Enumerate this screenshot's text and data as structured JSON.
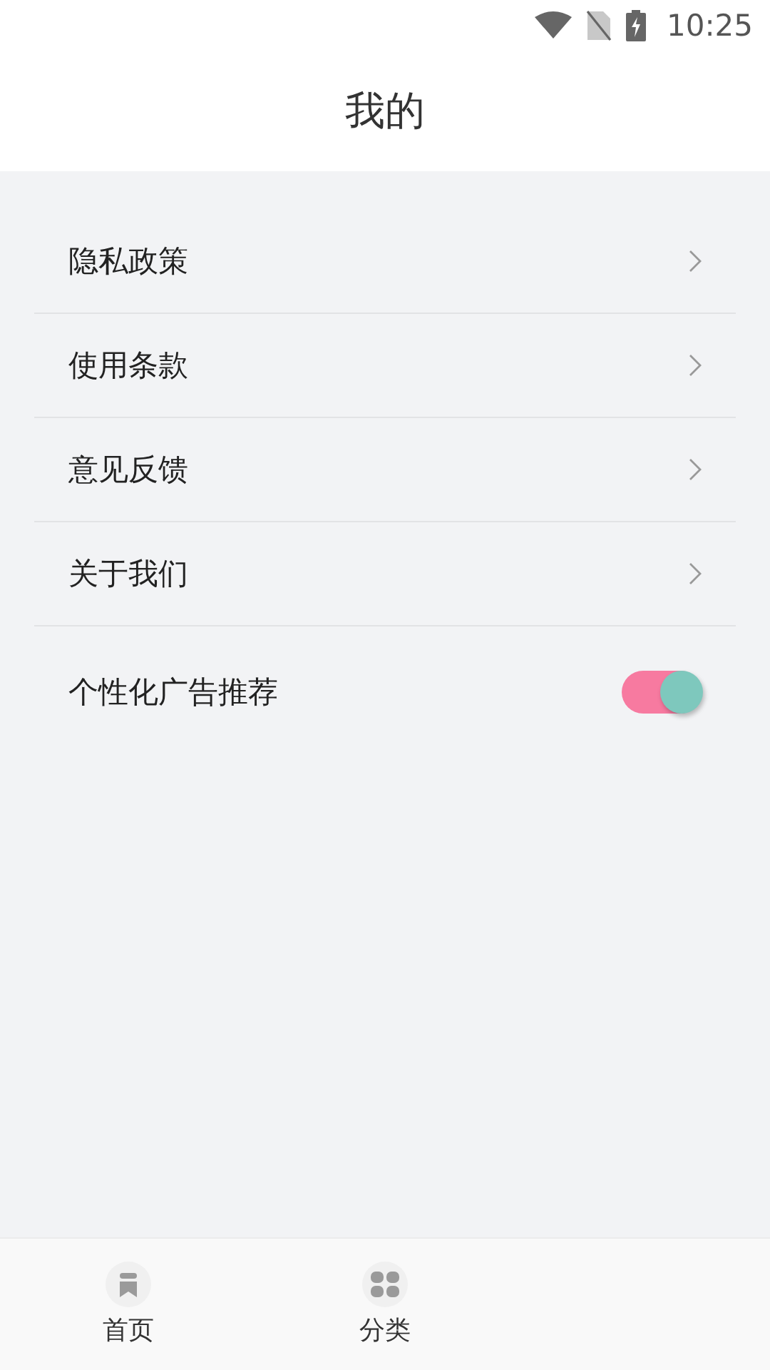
{
  "status_bar": {
    "time": "10:25"
  },
  "header": {
    "title": "我的"
  },
  "settings": [
    {
      "kind": "link",
      "label": "隐私政策"
    },
    {
      "kind": "link",
      "label": "使用条款"
    },
    {
      "kind": "link",
      "label": "意见反馈"
    },
    {
      "kind": "link",
      "label": "关于我们"
    },
    {
      "kind": "toggle",
      "label": "个性化广告推荐",
      "on": true
    }
  ],
  "bottom_nav": [
    {
      "label": "首页",
      "kind": "home"
    },
    {
      "label": "分类",
      "kind": "category"
    }
  ]
}
